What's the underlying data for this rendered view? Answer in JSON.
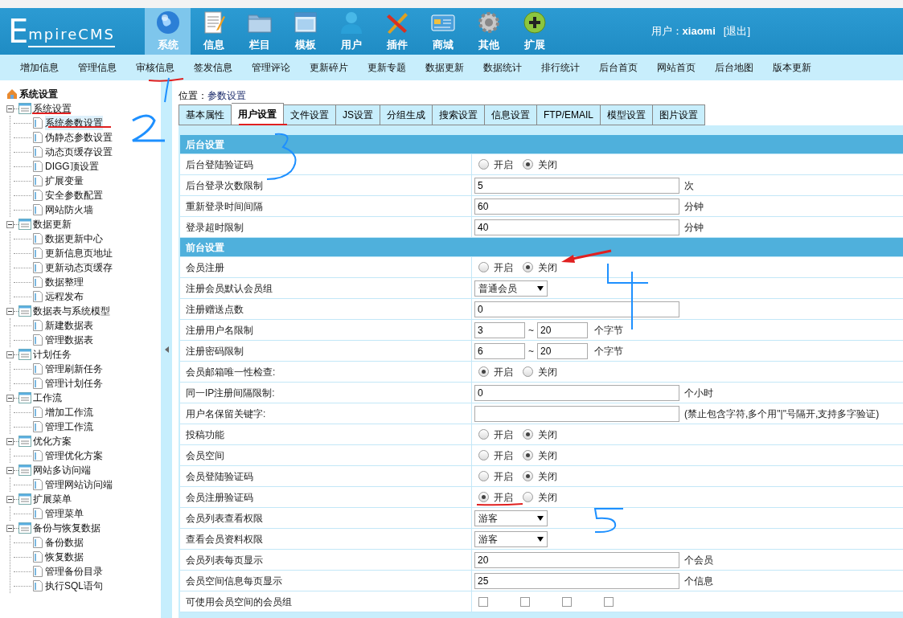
{
  "header": {
    "logo": "EmpireCMS",
    "nav": [
      {
        "label": "系统",
        "selected": true
      },
      {
        "label": "信息",
        "selected": false
      },
      {
        "label": "栏目",
        "selected": false
      },
      {
        "label": "模板",
        "selected": false
      },
      {
        "label": "用户",
        "selected": false
      },
      {
        "label": "插件",
        "selected": false
      },
      {
        "label": "商城",
        "selected": false
      },
      {
        "label": "其他",
        "selected": false
      },
      {
        "label": "扩展",
        "selected": false
      }
    ],
    "user_label": "用户：",
    "user_name": "xiaomi",
    "logout": "[退出]"
  },
  "sub_nav": [
    "增加信息",
    "管理信息",
    "审核信息",
    "签发信息",
    "管理评论",
    "更新碎片",
    "更新专题",
    "数据更新",
    "数据统计",
    "排行统计",
    "后台首页",
    "网站首页",
    "后台地图",
    "版本更新"
  ],
  "sidebar": {
    "title": "系统设置",
    "groups": [
      {
        "label": "系统设置",
        "expanded": true,
        "children": [
          {
            "label": "系统参数设置",
            "selected": true
          },
          {
            "label": "伪静态参数设置",
            "selected": false
          },
          {
            "label": "动态页缓存设置",
            "selected": false
          },
          {
            "label": "DIGG顶设置",
            "selected": false
          },
          {
            "label": "扩展变量",
            "selected": false
          },
          {
            "label": "安全参数配置",
            "selected": false
          },
          {
            "label": "网站防火墙",
            "selected": false
          }
        ]
      },
      {
        "label": "数据更新",
        "expanded": true,
        "children": [
          {
            "label": "数据更新中心",
            "selected": false
          },
          {
            "label": "更新信息页地址",
            "selected": false
          },
          {
            "label": "更新动态页缓存",
            "selected": false
          },
          {
            "label": "数据整理",
            "selected": false
          },
          {
            "label": "远程发布",
            "selected": false
          }
        ]
      },
      {
        "label": "数据表与系统模型",
        "expanded": true,
        "children": [
          {
            "label": "新建数据表",
            "selected": false
          },
          {
            "label": "管理数据表",
            "selected": false
          }
        ]
      },
      {
        "label": "计划任务",
        "expanded": true,
        "children": [
          {
            "label": "管理刷新任务",
            "selected": false
          },
          {
            "label": "管理计划任务",
            "selected": false
          }
        ]
      },
      {
        "label": "工作流",
        "expanded": true,
        "children": [
          {
            "label": "增加工作流",
            "selected": false
          },
          {
            "label": "管理工作流",
            "selected": false
          }
        ]
      },
      {
        "label": "优化方案",
        "expanded": true,
        "children": [
          {
            "label": "管理优化方案",
            "selected": false
          }
        ]
      },
      {
        "label": "网站多访问端",
        "expanded": true,
        "children": [
          {
            "label": "管理网站访问端",
            "selected": false
          }
        ]
      },
      {
        "label": "扩展菜单",
        "expanded": true,
        "children": [
          {
            "label": "管理菜单",
            "selected": false
          }
        ]
      },
      {
        "label": "备份与恢复数据",
        "expanded": true,
        "children": [
          {
            "label": "备份数据",
            "selected": false
          },
          {
            "label": "恢复数据",
            "selected": false
          },
          {
            "label": "管理备份目录",
            "selected": false
          },
          {
            "label": "执行SQL语句",
            "selected": false
          }
        ]
      }
    ]
  },
  "breadcrumb": {
    "label": "位置：",
    "current": "参数设置"
  },
  "tabs": [
    {
      "label": "基本属性",
      "selected": false
    },
    {
      "label": "用户设置",
      "selected": true
    },
    {
      "label": "文件设置",
      "selected": false
    },
    {
      "label": "JS设置",
      "selected": false
    },
    {
      "label": "分组生成",
      "selected": false
    },
    {
      "label": "搜索设置",
      "selected": false
    },
    {
      "label": "信息设置",
      "selected": false
    },
    {
      "label": "FTP/EMAIL",
      "selected": false
    },
    {
      "label": "模型设置",
      "selected": false
    },
    {
      "label": "图片设置",
      "selected": false
    }
  ],
  "sections": [
    {
      "title": "后台设置",
      "rows": [
        {
          "kind": "radio",
          "label": "后台登陆验证码",
          "options": [
            {
              "label": "开启",
              "selected": false
            },
            {
              "label": "关闭",
              "selected": true
            }
          ]
        },
        {
          "kind": "text",
          "label": "后台登录次数限制",
          "value": "5",
          "unit": "次"
        },
        {
          "kind": "text",
          "label": "重新登录时间间隔",
          "value": "60",
          "unit": "分钟"
        },
        {
          "kind": "text",
          "label": "登录超时限制",
          "value": "40",
          "unit": "分钟"
        }
      ]
    },
    {
      "title": "前台设置",
      "rows": [
        {
          "kind": "radio",
          "label": "会员注册",
          "options": [
            {
              "label": "开启",
              "selected": false
            },
            {
              "label": "关闭",
              "selected": true
            }
          ]
        },
        {
          "kind": "select",
          "label": "注册会员默认会员组",
          "value": "普通会员"
        },
        {
          "kind": "text",
          "label": "注册赠送点数",
          "value": "0"
        },
        {
          "kind": "range",
          "label": "注册用户名限制",
          "min": "3",
          "separator": "~",
          "max": "20",
          "unit": "个字节"
        },
        {
          "kind": "range",
          "label": "注册密码限制",
          "min": "6",
          "separator": "~",
          "max": "20",
          "unit": "个字节"
        },
        {
          "kind": "radio",
          "label": "会员邮箱唯一性检查:",
          "options": [
            {
              "label": "开启",
              "selected": true
            },
            {
              "label": "关闭",
              "selected": false
            }
          ]
        },
        {
          "kind": "text",
          "label": "同一IP注册间隔限制:",
          "value": "0",
          "unit": "个小时"
        },
        {
          "kind": "text",
          "label": "用户名保留关键字:",
          "unit": "(禁止包含字符,多个用\"|\"号隔开,支持多字验证)"
        },
        {
          "kind": "radio",
          "label": "投稿功能",
          "options": [
            {
              "label": "开启",
              "selected": false
            },
            {
              "label": "关闭",
              "selected": true
            }
          ]
        },
        {
          "kind": "radio",
          "label": "会员空间",
          "options": [
            {
              "label": "开启",
              "selected": false
            },
            {
              "label": "关闭",
              "selected": true
            }
          ]
        },
        {
          "kind": "radio",
          "label": "会员登陆验证码",
          "options": [
            {
              "label": "开启",
              "selected": false
            },
            {
              "label": "关闭",
              "selected": true
            }
          ]
        },
        {
          "kind": "radio",
          "label": "会员注册验证码",
          "options": [
            {
              "label": "开启",
              "selected": true
            },
            {
              "label": "关闭",
              "selected": false
            }
          ]
        },
        {
          "kind": "select",
          "label": "会员列表查看权限",
          "value": "游客"
        },
        {
          "kind": "select",
          "label": "查看会员资料权限",
          "value": "游客"
        },
        {
          "kind": "text",
          "label": "会员列表每页显示",
          "value": "20",
          "unit": "个会员"
        },
        {
          "kind": "text",
          "label": "会员空间信息每页显示",
          "value": "25",
          "unit": "个信息"
        },
        {
          "kind": "checks",
          "label": "可使用会员空间的会员组",
          "options": [
            {
              "checked": false
            },
            {
              "checked": false
            },
            {
              "checked": false
            },
            {
              "checked": false
            }
          ]
        }
      ]
    }
  ]
}
